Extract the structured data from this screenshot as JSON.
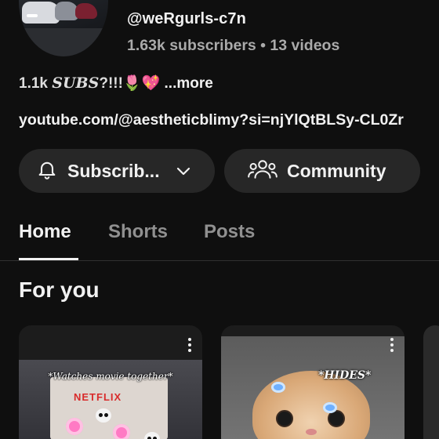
{
  "channel": {
    "handle": "@weRgurls-c7n",
    "stats": "1.63k subscribers • 13 videos",
    "description_prefix": "1.1k",
    "description_subs": "SUBS",
    "description_rest": "?!!!🌷💖",
    "description_more": "...more",
    "link": "youtube.com/@aestheticblimy?si=njYlQtBLSy-CL0Zr"
  },
  "buttons": {
    "subscribed_label": "Subscrib...",
    "community_label": "Community"
  },
  "tabs": [
    {
      "label": "Home",
      "active": true
    },
    {
      "label": "Shorts",
      "active": false
    },
    {
      "label": "Posts",
      "active": false
    }
  ],
  "section": {
    "title": "For you"
  },
  "cards": [
    {
      "caption": "*Watches movie together*",
      "tv_text": "NETFLIX"
    },
    {
      "caption": "*HIDES*"
    }
  ],
  "icons": {
    "bell": "bell-icon",
    "chevron": "chevron-down-icon",
    "community": "community-icon",
    "more": "more-vert-icon"
  },
  "colors": {
    "background": "#0f0f0f",
    "button_bg": "#272727",
    "text_primary": "#f1f1f1",
    "text_secondary": "#aaaaaa"
  }
}
